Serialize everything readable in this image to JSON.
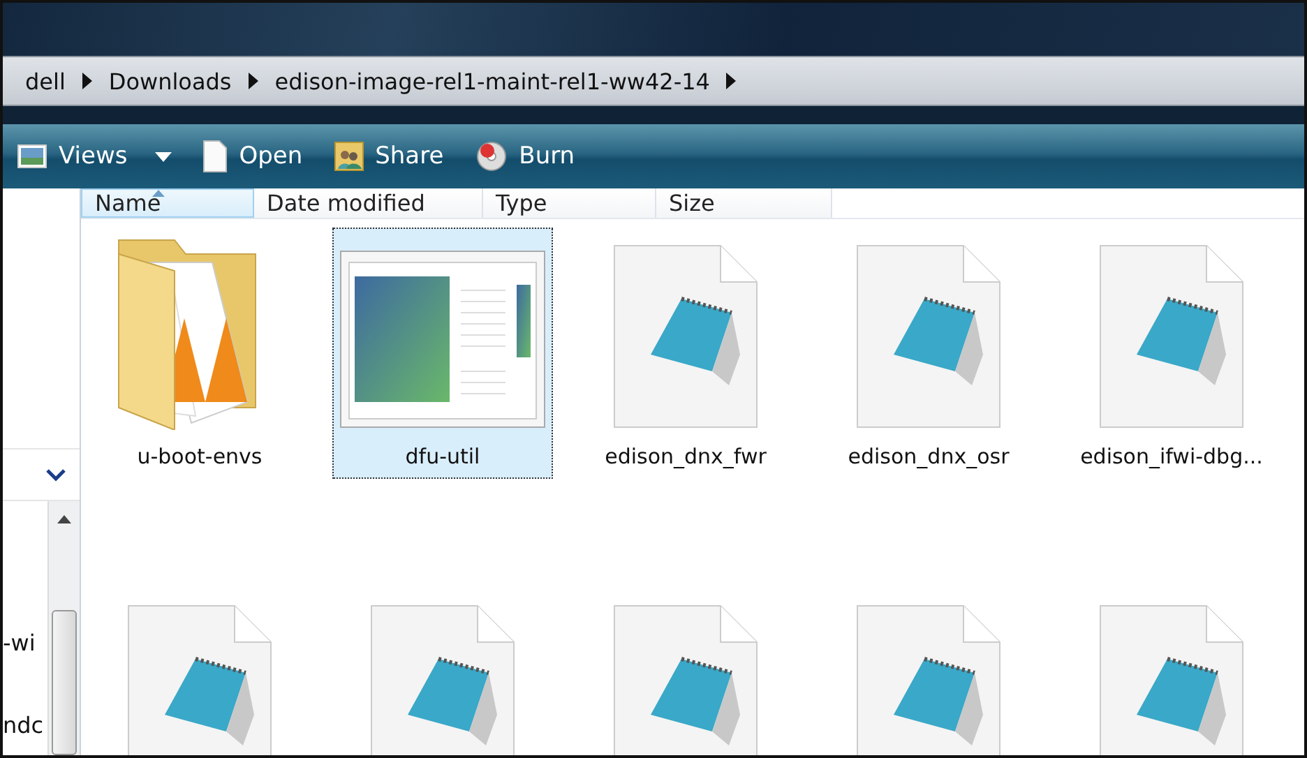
{
  "address_bar": {
    "crumbs": [
      "dell",
      "Downloads",
      "edison-image-rel1-maint-rel1-ww42-14"
    ]
  },
  "toolbar": [
    {
      "label": "Views",
      "kind": "views"
    },
    {
      "label": "Open",
      "kind": "open"
    },
    {
      "label": "Share",
      "kind": "share"
    },
    {
      "label": "Burn",
      "kind": "burn"
    }
  ],
  "nav_pane": {
    "texts": [
      "-wi",
      "ndc"
    ]
  },
  "columns": [
    {
      "label": "Name",
      "sorted": true
    },
    {
      "label": "Date modified",
      "sorted": false
    },
    {
      "label": "Type",
      "sorted": false
    },
    {
      "label": "Size",
      "sorted": false
    }
  ],
  "files": [
    {
      "name": "u-boot-envs",
      "kind": "folder",
      "selected": false
    },
    {
      "name": "dfu-util",
      "kind": "app",
      "selected": true
    },
    {
      "name": "edison_dnx_fwr",
      "kind": "text",
      "selected": false
    },
    {
      "name": "edison_dnx_osr",
      "kind": "text",
      "selected": false
    },
    {
      "name": "edison_ifwi-dbg...",
      "kind": "text",
      "selected": false
    },
    {
      "kind": "text",
      "selected": false
    },
    {
      "kind": "text",
      "selected": false
    },
    {
      "kind": "text",
      "selected": false
    },
    {
      "kind": "text",
      "selected": false
    },
    {
      "kind": "text",
      "selected": false
    }
  ]
}
